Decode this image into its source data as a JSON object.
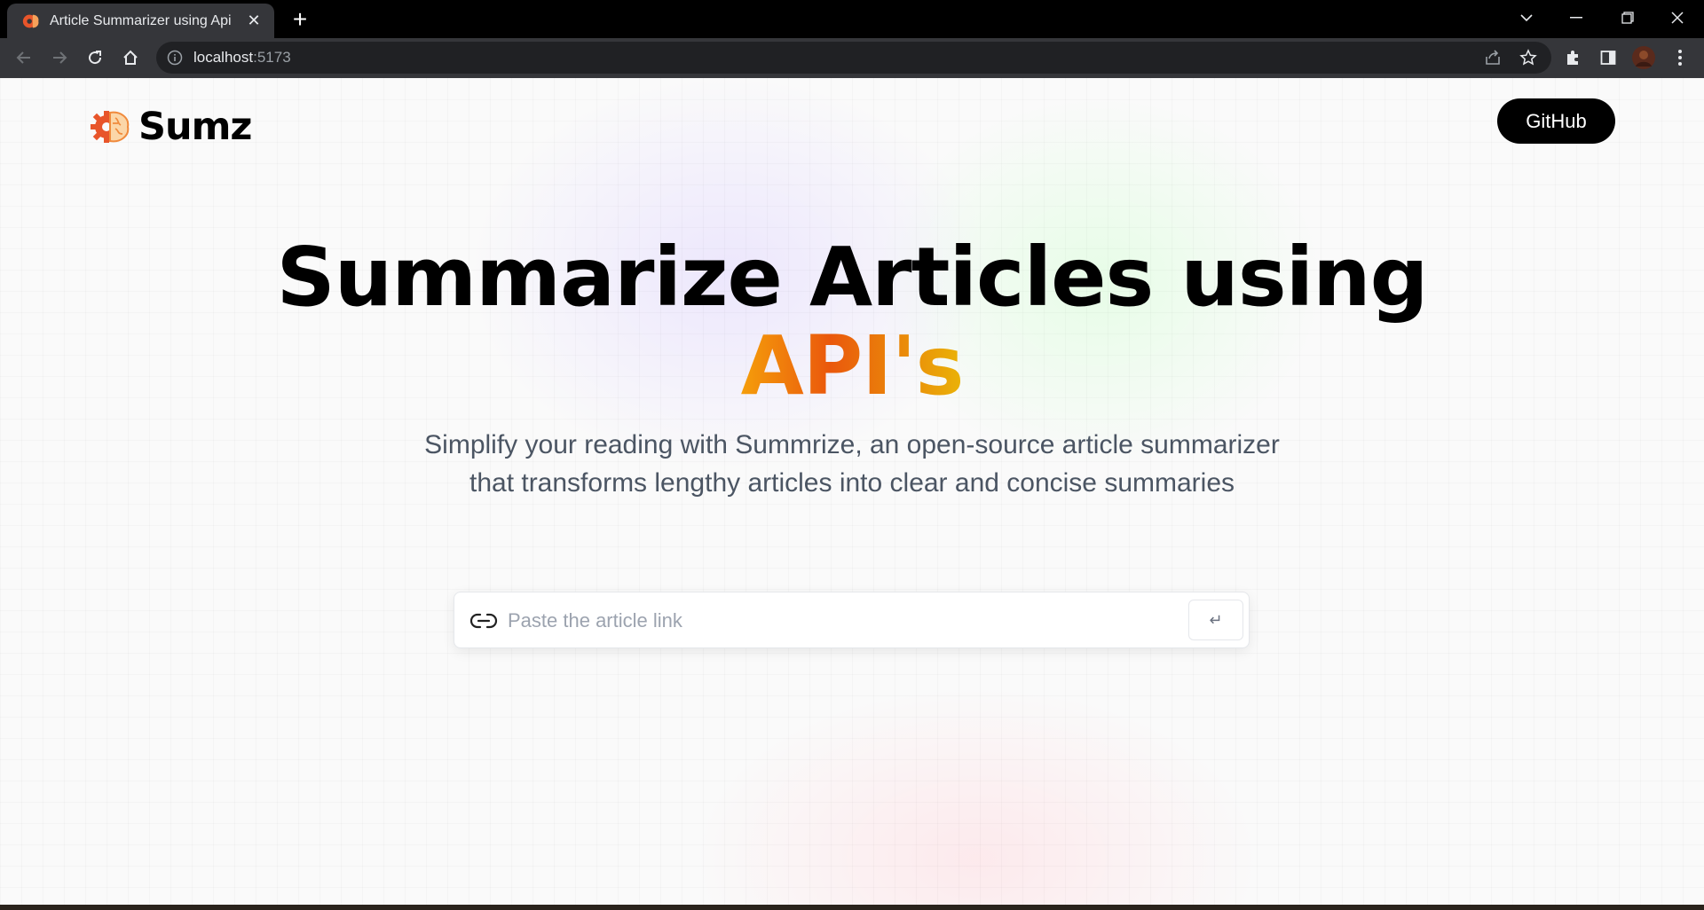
{
  "browser": {
    "tab_title": "Article Summarizer using Api",
    "tab_close": "✕",
    "new_tab": "+",
    "url_host": "localhost",
    "url_port": ":5173"
  },
  "header": {
    "logo_text": "Sumz",
    "github_label": "GitHub"
  },
  "hero": {
    "title_line1": "Summarize Articles using",
    "title_accent": "API's",
    "subtitle_line1": "Simplify your reading with Summrize, an open-source article summarizer",
    "subtitle_line2": "that transforms lengthy articles into clear and concise summaries"
  },
  "search": {
    "placeholder": "Paste the article link",
    "submit_symbol": "↵"
  },
  "colors": {
    "accent_orange": "#ea580c",
    "accent_amber": "#f59e0b",
    "button_black": "#000000"
  }
}
